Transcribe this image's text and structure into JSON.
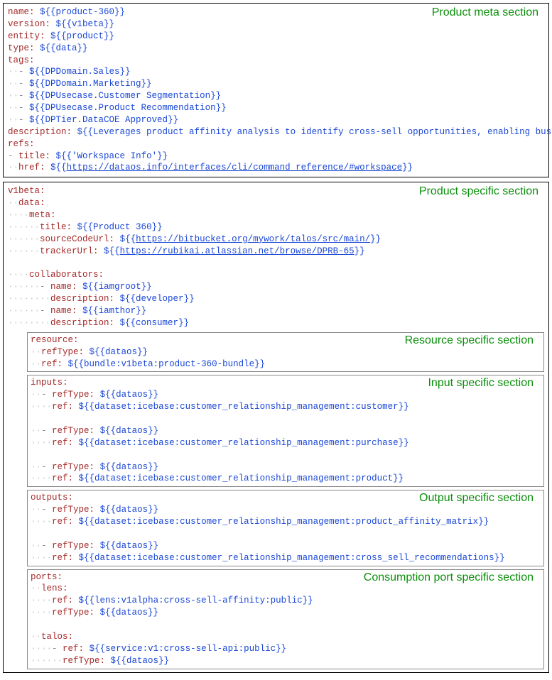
{
  "labels": {
    "meta": "Product meta section",
    "specific": "Product specific section",
    "resource": "Resource specific section",
    "input": "Input specific section",
    "output": "Output specific section",
    "port": "Consumption port specific section"
  },
  "meta": {
    "name_key": "name",
    "name_val": "${{product-360}}",
    "version_key": "version",
    "version_val": "${{v1beta}}",
    "entity_key": "entity",
    "entity_val": "${{product}}",
    "type_key": "type",
    "type_val": "${{data}}",
    "tags_key": "tags",
    "tag1": "${{DPDomain.Sales}}",
    "tag2": "${{DPDomain.Marketing}}",
    "tag3": "${{DPUsecase.Customer Segmentation}}",
    "tag4": "${{DPUsecase.Product Recommendation}}",
    "tag5": "${{DPTier.DataCOE Approved}}",
    "description_key": "description",
    "description_val": "${{Leverages product affinity analysis to identify cross-sell opportunities, enabling businesses",
    "refs_key": "refs",
    "ref_title_key": "title",
    "ref_title_val": "${{'Workspace Info'}}",
    "ref_href_key": "href",
    "ref_href_prefix": "${{",
    "ref_href_url": "https://dataos.info/interfaces/cli/command_reference/#workspace",
    "ref_href_suffix": "}}"
  },
  "spec": {
    "v1beta_key": "v1beta",
    "data_key": "data",
    "meta_key": "meta",
    "title_key": "title",
    "title_val": "${{Product 360}}",
    "sourceCodeUrl_key": "sourceCodeUrl",
    "src_prefix": "${{",
    "src_url": "https://bitbucket.org/mywork/talos/src/main/",
    "src_suffix": "}}",
    "trackerUrl_key": "trackerUrl",
    "trk_prefix": "${{",
    "trk_url": "https://rubikai.atlassian.net/browse/DPRB-65",
    "trk_suffix": "}}",
    "collab_key": "collaborators",
    "c1_name_key": "name",
    "c1_name_val": "${{iamgroot}}",
    "c1_desc_key": "description",
    "c1_desc_val": "${{developer}}",
    "c2_name_key": "name",
    "c2_name_val": "${{iamthor}}",
    "c2_desc_key": "description",
    "c2_desc_val": "${{consumer}}"
  },
  "resource": {
    "resource_key": "resource",
    "refType_key": "refType",
    "refType_val": "${{dataos}}",
    "ref_key": "ref",
    "ref_val": "${{bundle:v1beta:product-360-bundle}}"
  },
  "inputs": {
    "inputs_key": "inputs",
    "i1_refType_key": "refType",
    "i1_refType_val": "${{dataos}}",
    "i1_ref_key": "ref",
    "i1_ref_val": "${{dataset:icebase:customer_relationship_management:customer}}",
    "i2_refType_key": "refType",
    "i2_refType_val": "${{dataos}}",
    "i2_ref_key": "ref",
    "i2_ref_val": "${{dataset:icebase:customer_relationship_management:purchase}}",
    "i3_refType_key": "refType",
    "i3_refType_val": "${{dataos}}",
    "i3_ref_key": "ref",
    "i3_ref_val": "${{dataset:icebase:customer_relationship_management:product}}"
  },
  "outputs": {
    "outputs_key": "outputs",
    "o1_refType_key": "refType",
    "o1_refType_val": "${{dataos}}",
    "o1_ref_key": "ref",
    "o1_ref_val": "${{dataset:icebase:customer_relationship_management:product_affinity_matrix}}",
    "o2_refType_key": "refType",
    "o2_refType_val": "${{dataos}}",
    "o2_ref_key": "ref",
    "o2_ref_val": "${{dataset:icebase:customer_relationship_management:cross_sell_recommendations}}"
  },
  "ports": {
    "ports_key": "ports",
    "lens_key": "lens",
    "lens_ref_key": "ref",
    "lens_ref_val": "${{lens:v1alpha:cross-sell-affinity:public}}",
    "lens_refType_key": "refType",
    "lens_refType_val": "${{dataos}}",
    "talos_key": "talos",
    "talos_ref_key": "ref",
    "talos_ref_val": "${{service:v1:cross-sell-api:public}}",
    "talos_refType_key": "refType",
    "talos_refType_val": "${{dataos}}"
  }
}
